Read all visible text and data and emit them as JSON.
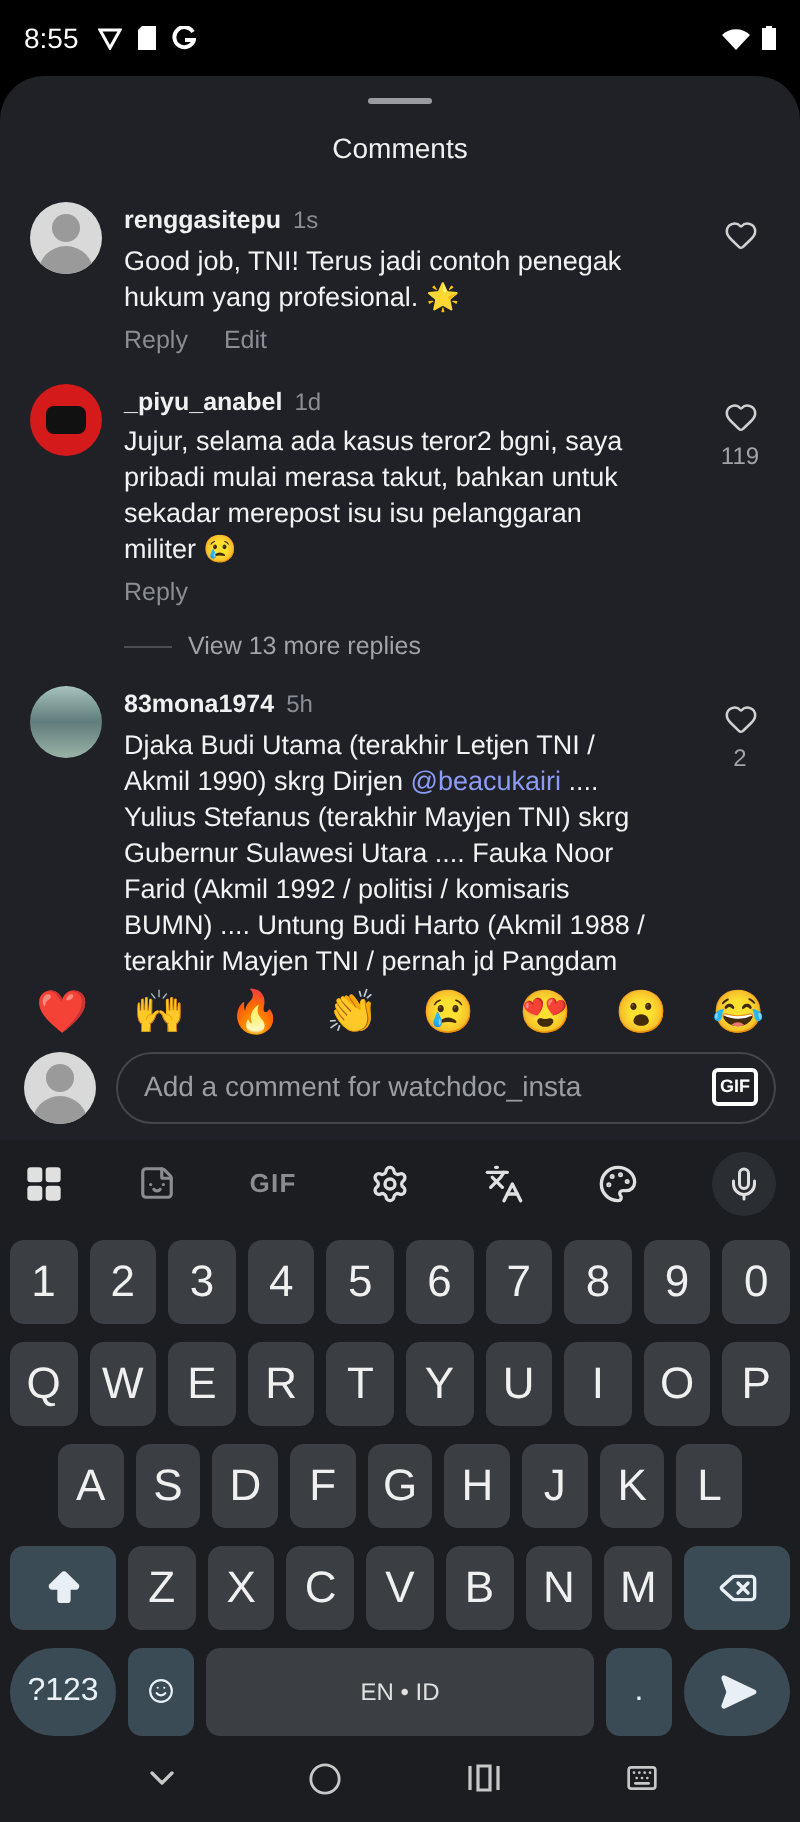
{
  "status_bar": {
    "time": "8:55"
  },
  "sheet": {
    "title": "Comments"
  },
  "comments": [
    {
      "username": "renggasitepu",
      "time": "1s",
      "text": "Good job, TNI! Terus jadi contoh penegak hukum yang profesional. 🌟",
      "kind": "silhouette",
      "actions": [
        "Reply",
        "Edit"
      ]
    },
    {
      "username": "_piyu_anabel",
      "time": "1d",
      "text": "Jujur, selama ada kasus teror2 bgni, saya pribadi mulai merasa takut, bahkan untuk sekadar merepost isu isu pelanggaran militer 😢",
      "kind": "emblem",
      "likes": "119",
      "actions": [
        "Reply"
      ],
      "view_replies": "View 13 more replies"
    },
    {
      "username": "83mona1974",
      "time": "5h",
      "text": "Djaka Budi Utama (terakhir Letjen TNI / Akmil 1990) skrg Dirjen ",
      "mention": "@beacukairi",
      "text_after": " .... Yulius Stefanus (terakhir Mayjen TNI) skrg Gubernur Sulawesi Utara .... Fauka Noor Farid (Akmil 1992 / politisi / komisaris BUMN) .... Untung Budi Harto (Akmil 1988 / terakhir Mayjen TNI / pernah jd Pangdam",
      "kind": "photo",
      "likes": "2"
    }
  ],
  "reactions": [
    "❤️",
    "🙌",
    "🔥",
    "👏",
    "😢",
    "😍",
    "😮",
    "😂"
  ],
  "comment_input": {
    "placeholder": "Add a comment for watchdoc_insta",
    "gif": "GIF"
  },
  "keyboard": {
    "toolbar_gif": "GIF",
    "rows": [
      [
        "1",
        "2",
        "3",
        "4",
        "5",
        "6",
        "7",
        "8",
        "9",
        "0"
      ],
      [
        "Q",
        "W",
        "E",
        "R",
        "T",
        "Y",
        "U",
        "I",
        "O",
        "P"
      ],
      [
        "A",
        "S",
        "D",
        "F",
        "G",
        "H",
        "J",
        "K",
        "L"
      ],
      [
        "Z",
        "X",
        "C",
        "V",
        "B",
        "N",
        "M"
      ]
    ],
    "symbols": "?123",
    "space": "EN • ID",
    "period": "."
  }
}
